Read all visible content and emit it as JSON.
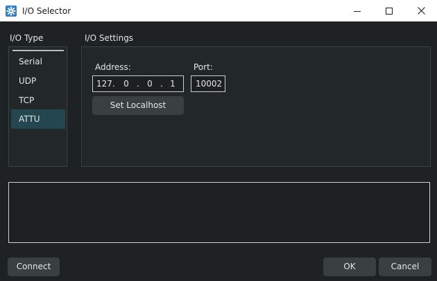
{
  "window": {
    "title": "I/O Selector",
    "controls": [
      "minimize-icon",
      "maximize-icon",
      "close-icon"
    ]
  },
  "io_type": {
    "label": "I/O Type",
    "items": [
      {
        "label": "Serial",
        "selected": false
      },
      {
        "label": "UDP",
        "selected": false
      },
      {
        "label": "TCP",
        "selected": false
      },
      {
        "label": "ATTU",
        "selected": true
      }
    ]
  },
  "io_settings": {
    "label": "I/O Settings",
    "address_label": "Address:",
    "address_octets": [
      "127",
      "0",
      "0",
      "1"
    ],
    "address_separator": ".",
    "port_label": "Port:",
    "port_value": "10002",
    "set_localhost_label": "Set Localhost"
  },
  "output": {
    "value": ""
  },
  "footer": {
    "connect_label": "Connect",
    "ok_label": "OK",
    "cancel_label": "Cancel"
  },
  "colors": {
    "background": "#1e2224",
    "selected_item": "#23464f",
    "button": "#3a3f42",
    "app_icon": "#2f7fc6"
  }
}
